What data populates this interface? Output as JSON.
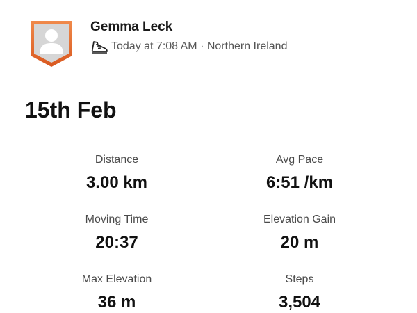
{
  "athlete": {
    "name": "Gemma Leck",
    "meta": "Today at 7:08 AM · Northern Ireland",
    "avatar_icon": "user-silhouette-icon",
    "activity_icon": "running-shoe-icon",
    "badge_color": "#e8743b"
  },
  "activity": {
    "date": "15th Feb"
  },
  "stats": [
    {
      "label": "Distance",
      "value": "3.00 km"
    },
    {
      "label": "Avg Pace",
      "value": "6:51 /km"
    },
    {
      "label": "Moving Time",
      "value": "20:37"
    },
    {
      "label": "Elevation Gain",
      "value": "20 m"
    },
    {
      "label": "Max Elevation",
      "value": "36 m"
    },
    {
      "label": "Steps",
      "value": "3,504"
    }
  ]
}
